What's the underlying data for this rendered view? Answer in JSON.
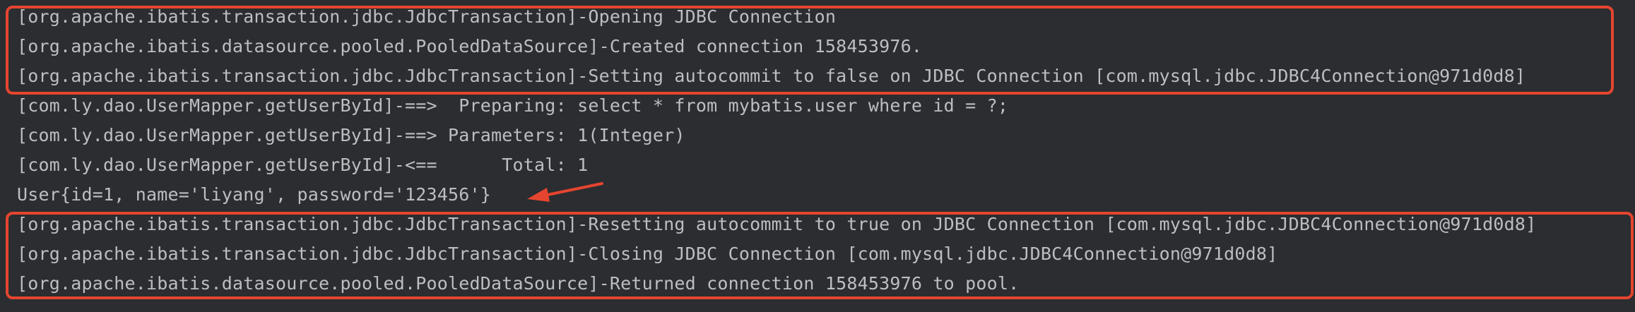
{
  "console": {
    "lines": [
      "[org.apache.ibatis.transaction.jdbc.JdbcTransaction]-Opening JDBC Connection",
      "[org.apache.ibatis.datasource.pooled.PooledDataSource]-Created connection 158453976.",
      "[org.apache.ibatis.transaction.jdbc.JdbcTransaction]-Setting autocommit to false on JDBC Connection [com.mysql.jdbc.JDBC4Connection@971d0d8]",
      "[com.ly.dao.UserMapper.getUserById]-==>  Preparing: select * from mybatis.user where id = ?;",
      "[com.ly.dao.UserMapper.getUserById]-==> Parameters: 1(Integer)",
      "[com.ly.dao.UserMapper.getUserById]-<==      Total: 1",
      "User{id=1, name='liyang', password='123456'}",
      "[org.apache.ibatis.transaction.jdbc.JdbcTransaction]-Resetting autocommit to true on JDBC Connection [com.mysql.jdbc.JDBC4Connection@971d0d8]",
      "[org.apache.ibatis.transaction.jdbc.JdbcTransaction]-Closing JDBC Connection [com.mysql.jdbc.JDBC4Connection@971d0d8]",
      "[org.apache.ibatis.datasource.pooled.PooledDataSource]-Returned connection 158453976 to pool."
    ]
  },
  "colors": {
    "background": "#2b2d30",
    "text": "#bcbec4",
    "annotation": "#e5452f"
  },
  "annotations": {
    "arrow_icon": "arrow-left-icon"
  }
}
